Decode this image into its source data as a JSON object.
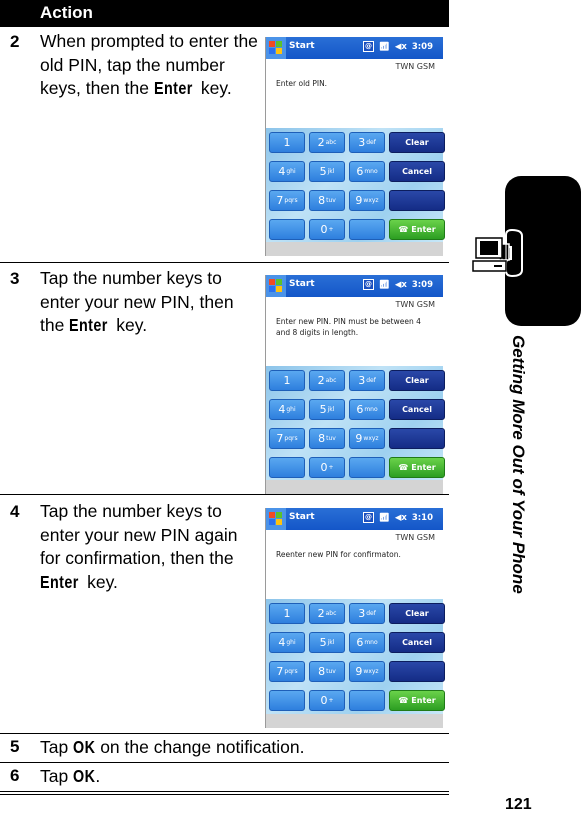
{
  "header": {
    "column_label": "Action"
  },
  "steps": [
    {
      "num": "2",
      "parts": [
        "When prompted to enter the old PIN, tap the number keys, then the ",
        "Enter",
        " key."
      ]
    },
    {
      "num": "3",
      "parts": [
        "Tap the number keys to enter your new PIN, then the ",
        "Enter",
        " key."
      ]
    },
    {
      "num": "4",
      "parts": [
        "Tap the number keys to enter your new PIN again for confirmation, then the ",
        "Enter",
        " key."
      ]
    },
    {
      "num": "5",
      "parts": [
        "Tap ",
        "OK",
        " on the change notification."
      ]
    },
    {
      "num": "6",
      "parts": [
        "Tap ",
        "OK",
        "."
      ]
    }
  ],
  "screens": [
    {
      "start": "Start",
      "time": "3:09",
      "carrier": "TWN GSM",
      "message": "Enter old PIN."
    },
    {
      "start": "Start",
      "time": "3:09",
      "carrier": "TWN GSM",
      "message": "Enter new PIN. PIN must be between 4 and 8 digits in length."
    },
    {
      "start": "Start",
      "time": "3:10",
      "carrier": "TWN GSM",
      "message": "Reenter new PIN for confirmaton."
    }
  ],
  "keypad": {
    "keys": [
      {
        "main": "1",
        "sub": "",
        "style": "num"
      },
      {
        "main": "2",
        "sub": "abc",
        "style": "num"
      },
      {
        "main": "3",
        "sub": "def",
        "style": "num"
      },
      {
        "main": "Clear",
        "sub": "",
        "style": "dark"
      },
      {
        "main": "4",
        "sub": "ghi",
        "style": "num"
      },
      {
        "main": "5",
        "sub": "jkl",
        "style": "num"
      },
      {
        "main": "6",
        "sub": "mno",
        "style": "num"
      },
      {
        "main": "Cancel",
        "sub": "",
        "style": "dark"
      },
      {
        "main": "7",
        "sub": "pqrs",
        "style": "num"
      },
      {
        "main": "8",
        "sub": "tuv",
        "style": "num"
      },
      {
        "main": "9",
        "sub": "wxyz",
        "style": "num"
      },
      {
        "main": "",
        "sub": "",
        "style": "dark"
      },
      {
        "main": "",
        "sub": "",
        "style": "num"
      },
      {
        "main": "0",
        "sub": "+",
        "style": "num"
      },
      {
        "main": "",
        "sub": "",
        "style": "num"
      },
      {
        "main": "Enter",
        "sub": "",
        "style": "green"
      }
    ]
  },
  "sidebar": {
    "section_title": "Getting More Out of Your Phone",
    "icon": "computer-phone-icon"
  },
  "page_number": "121"
}
